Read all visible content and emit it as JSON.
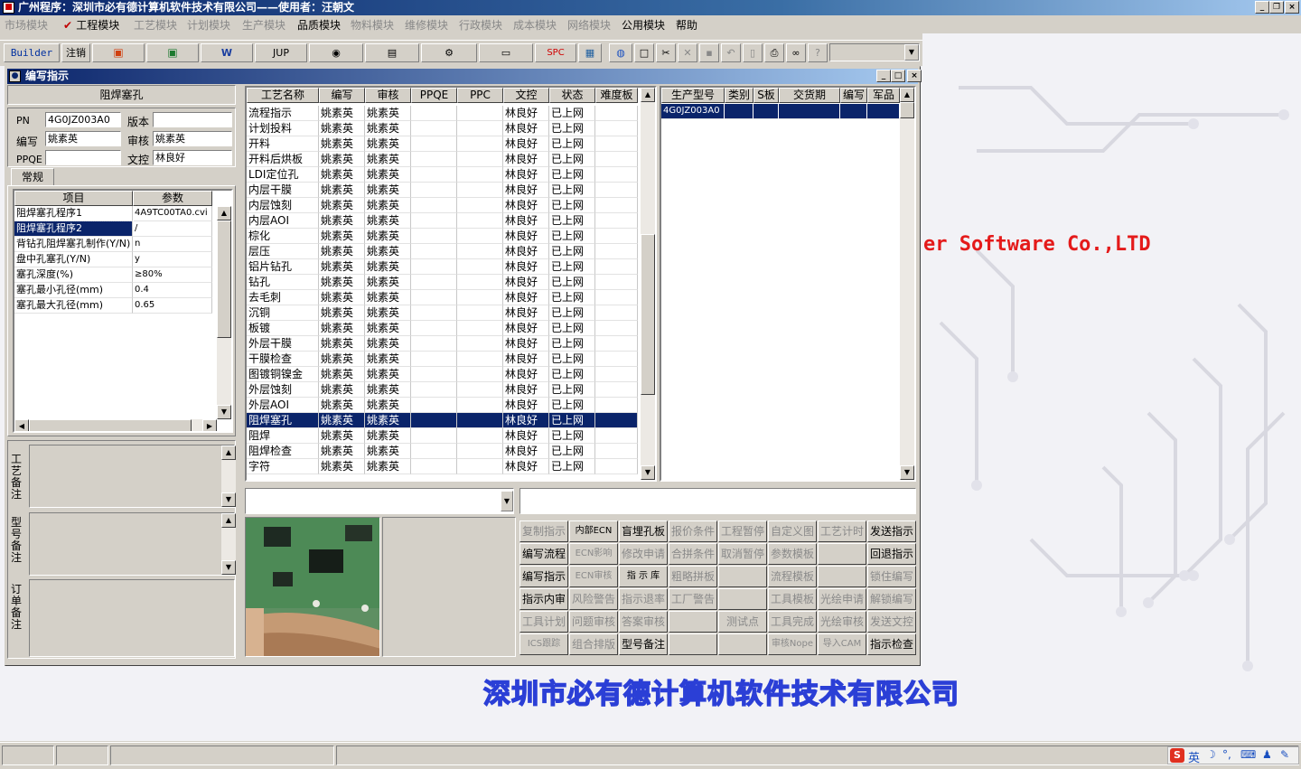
{
  "app": {
    "title": "广州程序：深圳市必有德计算机软件技术有限公司——使用者：汪朝文"
  },
  "menu": [
    {
      "label": "市场模块",
      "enabled": false
    },
    {
      "label": "工程模块",
      "enabled": true,
      "checked": true
    },
    {
      "label": "工艺模块",
      "enabled": false
    },
    {
      "label": "计划模块",
      "enabled": false
    },
    {
      "label": "生产模块",
      "enabled": false
    },
    {
      "label": "品质模块",
      "enabled": true
    },
    {
      "label": "物料模块",
      "enabled": false
    },
    {
      "label": "维修模块",
      "enabled": false
    },
    {
      "label": "行政模块",
      "enabled": false
    },
    {
      "label": "成本模块",
      "enabled": false
    },
    {
      "label": "网络模块",
      "enabled": false
    },
    {
      "label": "公用模块",
      "enabled": true
    },
    {
      "label": "帮助",
      "enabled": true
    }
  ],
  "toolbar": {
    "builder": "Builder",
    "logout": "注销",
    "jup": "JUP",
    "spc": "SPC",
    "combo_value": ""
  },
  "window": {
    "title": "编写指示"
  },
  "left": {
    "header": "阻焊塞孔",
    "pn_label": "PN",
    "pn_value": "4G0JZ003A0",
    "version_label": "版本",
    "version_value": "",
    "writer_label": "编写",
    "writer_value": "姚素英",
    "review_label": "审核",
    "review_value": "姚素英",
    "ppqe_label": "PPQE",
    "ppqe_value": "",
    "doc_label": "文控",
    "doc_value": "林良好",
    "tab": "常规",
    "param_headers": [
      "项目",
      "参数"
    ],
    "params": [
      [
        "阻焊塞孔程序1",
        "4A9TC00TA0.cvi"
      ],
      [
        "阻焊塞孔程序2",
        "/"
      ],
      [
        "背钻孔阻焊塞孔制作(Y/N)",
        "n"
      ],
      [
        "盘中孔塞孔(Y/N)",
        "y"
      ],
      [
        "塞孔深度(%)",
        "≥80%"
      ],
      [
        "塞孔最小孔径(mm)",
        "0.4"
      ],
      [
        "塞孔最大孔径(mm)",
        "0.65"
      ]
    ],
    "selected_param": 1,
    "remark_labels": [
      "工艺备注",
      "型号备注",
      "订单备注"
    ]
  },
  "process": {
    "headers": [
      "工艺名称",
      "编写",
      "审核",
      "PPQE",
      "PPC",
      "文控",
      "状态",
      "难度板"
    ],
    "rows": [
      [
        "流程指示",
        "姚素英",
        "姚素英",
        "",
        "",
        "林良好",
        "已上网",
        ""
      ],
      [
        "计划投料",
        "姚素英",
        "姚素英",
        "",
        "",
        "林良好",
        "已上网",
        ""
      ],
      [
        "开料",
        "姚素英",
        "姚素英",
        "",
        "",
        "林良好",
        "已上网",
        ""
      ],
      [
        "开料后烘板",
        "姚素英",
        "姚素英",
        "",
        "",
        "林良好",
        "已上网",
        ""
      ],
      [
        "LDI定位孔",
        "姚素英",
        "姚素英",
        "",
        "",
        "林良好",
        "已上网",
        ""
      ],
      [
        "内层干膜",
        "姚素英",
        "姚素英",
        "",
        "",
        "林良好",
        "已上网",
        ""
      ],
      [
        "内层蚀刻",
        "姚素英",
        "姚素英",
        "",
        "",
        "林良好",
        "已上网",
        ""
      ],
      [
        "内层AOI",
        "姚素英",
        "姚素英",
        "",
        "",
        "林良好",
        "已上网",
        ""
      ],
      [
        "棕化",
        "姚素英",
        "姚素英",
        "",
        "",
        "林良好",
        "已上网",
        ""
      ],
      [
        "层压",
        "姚素英",
        "姚素英",
        "",
        "",
        "林良好",
        "已上网",
        ""
      ],
      [
        "铝片钻孔",
        "姚素英",
        "姚素英",
        "",
        "",
        "林良好",
        "已上网",
        ""
      ],
      [
        "钻孔",
        "姚素英",
        "姚素英",
        "",
        "",
        "林良好",
        "已上网",
        ""
      ],
      [
        "去毛刺",
        "姚素英",
        "姚素英",
        "",
        "",
        "林良好",
        "已上网",
        ""
      ],
      [
        "沉铜",
        "姚素英",
        "姚素英",
        "",
        "",
        "林良好",
        "已上网",
        ""
      ],
      [
        "板镀",
        "姚素英",
        "姚素英",
        "",
        "",
        "林良好",
        "已上网",
        ""
      ],
      [
        "外层干膜",
        "姚素英",
        "姚素英",
        "",
        "",
        "林良好",
        "已上网",
        ""
      ],
      [
        "干膜检查",
        "姚素英",
        "姚素英",
        "",
        "",
        "林良好",
        "已上网",
        ""
      ],
      [
        "图镀铜镍金",
        "姚素英",
        "姚素英",
        "",
        "",
        "林良好",
        "已上网",
        ""
      ],
      [
        "外层蚀刻",
        "姚素英",
        "姚素英",
        "",
        "",
        "林良好",
        "已上网",
        ""
      ],
      [
        "外层AOI",
        "姚素英",
        "姚素英",
        "",
        "",
        "林良好",
        "已上网",
        ""
      ],
      [
        "阻焊塞孔",
        "姚素英",
        "姚素英",
        "",
        "",
        "林良好",
        "已上网",
        ""
      ],
      [
        "阻焊",
        "姚素英",
        "姚素英",
        "",
        "",
        "林良好",
        "已上网",
        ""
      ],
      [
        "阻焊检查",
        "姚素英",
        "姚素英",
        "",
        "",
        "林良好",
        "已上网",
        ""
      ],
      [
        "字符",
        "姚素英",
        "姚素英",
        "",
        "",
        "林良好",
        "已上网",
        ""
      ]
    ],
    "selected_row": 20
  },
  "order": {
    "headers": [
      "生产型号",
      "类别",
      "S板",
      "交货期",
      "编写",
      "军品"
    ],
    "rows": [
      [
        "4G0JZ003A0",
        "",
        "",
        "",
        "",
        ""
      ]
    ]
  },
  "buttons": [
    [
      {
        "label": "复制指示",
        "enabled": false
      },
      {
        "label": "内部ECN",
        "enabled": true
      },
      {
        "label": "盲埋孔板",
        "enabled": true
      },
      {
        "label": "报价条件",
        "enabled": false
      },
      {
        "label": "工程暂停",
        "enabled": false
      },
      {
        "label": "自定义图",
        "enabled": false
      },
      {
        "label": "工艺计时",
        "enabled": false
      },
      {
        "label": "发送指示",
        "enabled": true
      }
    ],
    [
      {
        "label": "编写流程",
        "enabled": true
      },
      {
        "label": "ECN影响",
        "enabled": false
      },
      {
        "label": "修改申请",
        "enabled": false
      },
      {
        "label": "合拼条件",
        "enabled": false
      },
      {
        "label": "取消暂停",
        "enabled": false
      },
      {
        "label": "参数模板",
        "enabled": false
      },
      {
        "label": "",
        "enabled": false
      },
      {
        "label": "回退指示",
        "enabled": true
      }
    ],
    [
      {
        "label": "编写指示",
        "enabled": true
      },
      {
        "label": "ECN审核",
        "enabled": false
      },
      {
        "label": "指 示 库",
        "enabled": true
      },
      {
        "label": "粗略拼板",
        "enabled": false
      },
      {
        "label": "",
        "enabled": false
      },
      {
        "label": "流程模板",
        "enabled": false
      },
      {
        "label": "",
        "enabled": false
      },
      {
        "label": "锁住编写",
        "enabled": false
      }
    ],
    [
      {
        "label": "指示内审",
        "enabled": true
      },
      {
        "label": "风险警告",
        "enabled": false
      },
      {
        "label": "指示退率",
        "enabled": false
      },
      {
        "label": "工厂警告",
        "enabled": false
      },
      {
        "label": "",
        "enabled": false
      },
      {
        "label": "工具模板",
        "enabled": false
      },
      {
        "label": "光绘申请",
        "enabled": false
      },
      {
        "label": "解锁编写",
        "enabled": false
      }
    ],
    [
      {
        "label": "工具计划",
        "enabled": false
      },
      {
        "label": "问题审核",
        "enabled": false
      },
      {
        "label": "答案审核",
        "enabled": false
      },
      {
        "label": "",
        "enabled": false
      },
      {
        "label": "测试点",
        "enabled": false
      },
      {
        "label": "工具完成",
        "enabled": false
      },
      {
        "label": "光绘审核",
        "enabled": false
      },
      {
        "label": "发送文控",
        "enabled": false
      }
    ],
    [
      {
        "label": "ICS跟踪",
        "enabled": false
      },
      {
        "label": "组合排版",
        "enabled": false
      },
      {
        "label": "型号备注",
        "enabled": true
      },
      {
        "label": "",
        "enabled": false
      },
      {
        "label": "",
        "enabled": false
      },
      {
        "label": "审核Nope",
        "enabled": false
      },
      {
        "label": "导入CAM",
        "enabled": false
      },
      {
        "label": "指示检查",
        "enabled": true
      }
    ]
  ],
  "background": {
    "software_text": "er Software Co.,LTD",
    "company_text": "深圳市必有德计算机软件技术有限公司"
  },
  "taskbar": {
    "ime": "英"
  }
}
